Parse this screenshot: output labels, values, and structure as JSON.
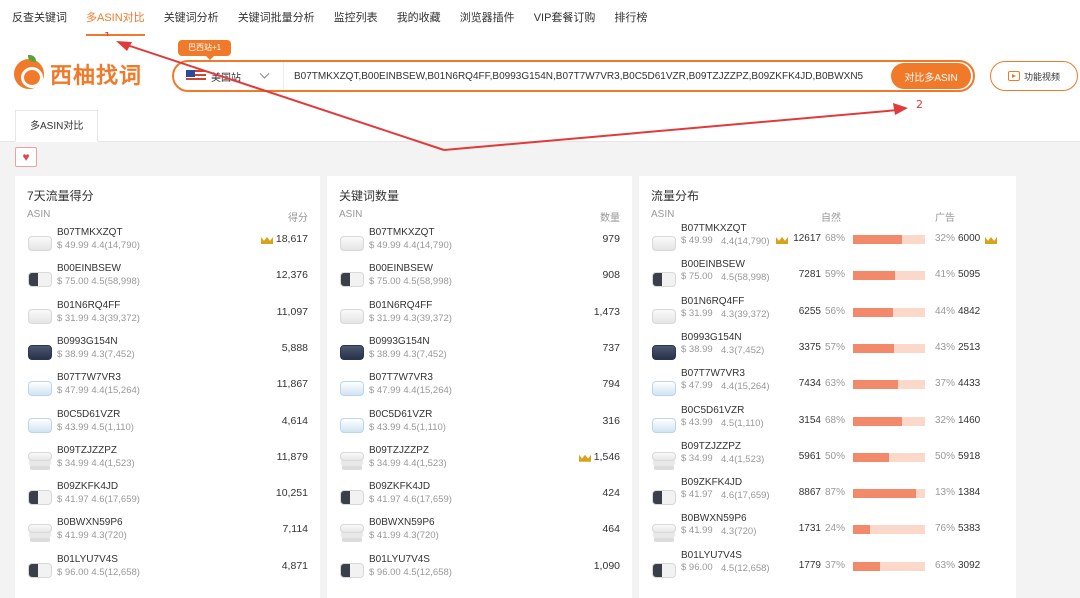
{
  "nav": {
    "items": [
      "反查关键词",
      "多ASIN对比",
      "关键词分析",
      "关键词批量分析",
      "监控列表",
      "我的收藏",
      "浏览器插件",
      "VIP套餐订购",
      "排行榜"
    ],
    "active_index": 1
  },
  "annotations": {
    "step1": "1",
    "step2": "2"
  },
  "colors": {
    "accent": "#f07a2a",
    "bar_fill": "#f2896a",
    "bar_bg": "#fbd8c9",
    "crown": "#d9a21b",
    "arrow": "#e23a3a"
  },
  "logo": {
    "text": "西柚找词",
    "icon": "grapefruit-logo-icon"
  },
  "search": {
    "badge": "巴西站+1",
    "site": "美国站",
    "value": "B07TMKXZQT,B00EINBSEW,B01N6RQ4FF,B0993G154N,B07T7W7VR3,B0C5D61VZR,B09TZJZZPZ,B09ZKFK4JD,B0BWXN5",
    "compare_label": "对比多ASIN"
  },
  "video_label": "功能视频",
  "tab_label": "多ASIN对比",
  "fav_icon": "♥",
  "panels": {
    "score": {
      "title": "7天流量得分",
      "col_left": "ASIN",
      "col_right": "得分"
    },
    "keywords": {
      "title": "关键词数量",
      "col_left": "ASIN",
      "col_right": "数量"
    },
    "traffic": {
      "title": "流量分布",
      "col_left": "ASIN",
      "col_nat": "自然",
      "col_ad": "广告"
    }
  },
  "products": [
    {
      "asin": "B07TMKXZQT",
      "price": "$ 49.99",
      "rating": "4.4(14,790)",
      "score": "18,617",
      "kw": "979",
      "nat": "12617",
      "nat_pct": "68%",
      "ad_pct": "32%",
      "ad": "6000",
      "thumb": "white",
      "score_crown": true,
      "ad_crown": true,
      "nat_crown": true
    },
    {
      "asin": "B00EINBSEW",
      "price": "$ 75.00",
      "rating": "4.5(58,998)",
      "score": "12,376",
      "kw": "908",
      "nat": "7281",
      "nat_pct": "59%",
      "ad_pct": "41%",
      "ad": "5095",
      "thumb": "box"
    },
    {
      "asin": "B01N6RQ4FF",
      "price": "$ 31.99",
      "rating": "4.3(39,372)",
      "score": "11,097",
      "kw": "1,473",
      "nat": "6255",
      "nat_pct": "56%",
      "ad_pct": "44%",
      "ad": "4842",
      "thumb": "white"
    },
    {
      "asin": "B0993G154N",
      "price": "$ 38.99",
      "rating": "4.3(7,452)",
      "score": "5,888",
      "kw": "737",
      "nat": "3375",
      "nat_pct": "57%",
      "ad_pct": "43%",
      "ad": "2513",
      "thumb": "dark"
    },
    {
      "asin": "B07T7W7VR3",
      "price": "$ 47.99",
      "rating": "4.4(15,264)",
      "score": "11,867",
      "kw": "794",
      "nat": "7434",
      "nat_pct": "63%",
      "ad_pct": "37%",
      "ad": "4433",
      "thumb": "blue"
    },
    {
      "asin": "B0C5D61VZR",
      "price": "$ 43.99",
      "rating": "4.5(1,110)",
      "score": "4,614",
      "kw": "316",
      "nat": "3154",
      "nat_pct": "68%",
      "ad_pct": "32%",
      "ad": "1460",
      "thumb": "blue"
    },
    {
      "asin": "B09TZJZZPZ",
      "price": "$ 34.99",
      "rating": "4.4(1,523)",
      "score": "11,879",
      "kw": "1,546",
      "nat": "5961",
      "nat_pct": "50%",
      "ad_pct": "50%",
      "ad": "5918",
      "thumb": "stack",
      "kw_crown": true
    },
    {
      "asin": "B09ZKFK4JD",
      "price": "$ 41.97",
      "rating": "4.6(17,659)",
      "score": "10,251",
      "kw": "424",
      "nat": "8867",
      "nat_pct": "87%",
      "ad_pct": "13%",
      "ad": "1384",
      "thumb": "box"
    },
    {
      "asin": "B0BWXN59P6",
      "price": "$ 41.99",
      "rating": "4.3(720)",
      "score": "7,114",
      "kw": "464",
      "nat": "1731",
      "nat_pct": "24%",
      "ad_pct": "76%",
      "ad": "5383",
      "thumb": "stack"
    },
    {
      "asin": "B01LYU7V4S",
      "price": "$ 96.00",
      "rating": "4.5(12,658)",
      "score": "4,871",
      "kw": "1,090",
      "nat": "1779",
      "nat_pct": "37%",
      "ad_pct": "63%",
      "ad": "3092",
      "thumb": "box"
    }
  ]
}
